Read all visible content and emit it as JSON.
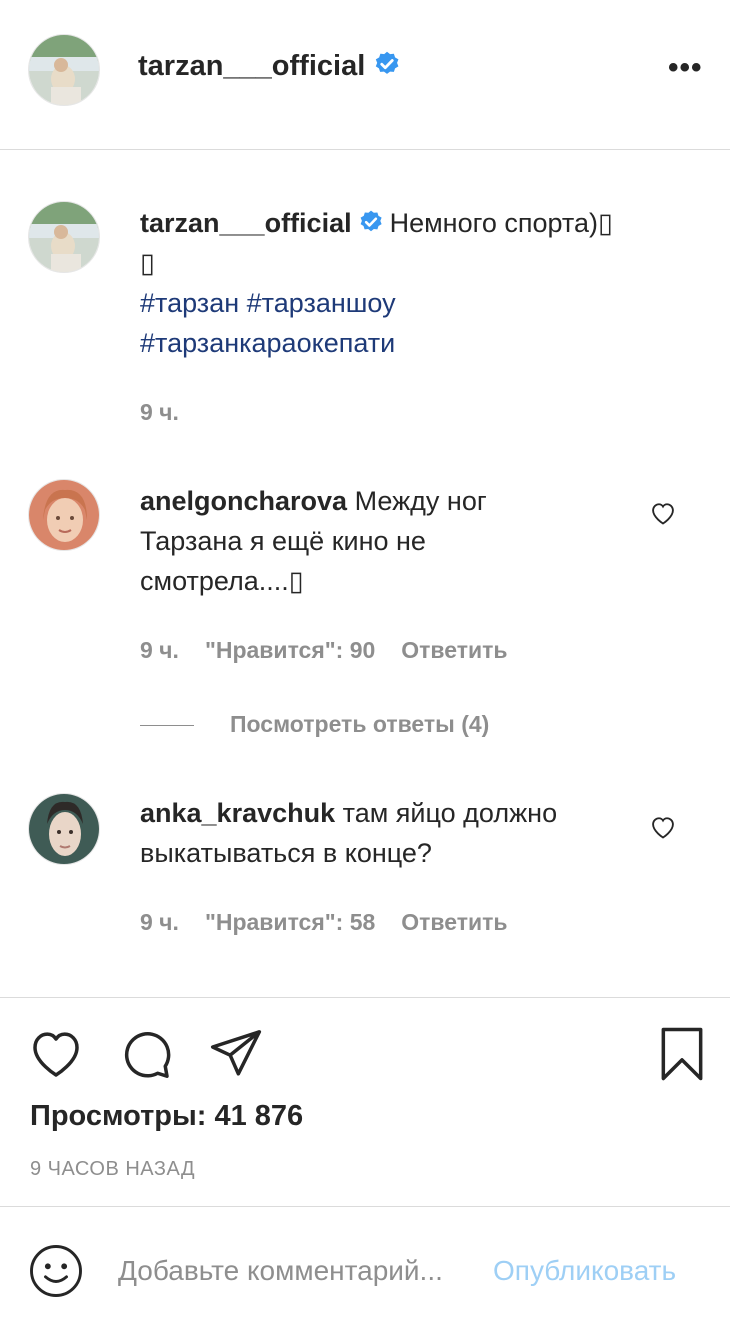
{
  "header": {
    "username": "tarzan___official",
    "more_label": "•••"
  },
  "caption": {
    "username": "tarzan___official",
    "text": "Немного спорта)▯",
    "text_line2": "▯",
    "hashtags": [
      "#тарзан",
      "#тарзаншоу",
      "#тарзанкараокепати"
    ],
    "time": "9 ч."
  },
  "comments": [
    {
      "username": "anelgoncharova",
      "text_line1": "Между ног",
      "text_line2": "Тарзана я ещё кино не",
      "text_line3": "смотрела....▯",
      "time": "9 ч.",
      "likes": "\"Нравится\": 90",
      "reply": "Ответить",
      "view_replies": "Посмотреть ответы (4)"
    },
    {
      "username": "anka_kravchuk",
      "text_line1": "там яйцо должно",
      "text_line2": "выкатываться в конце?",
      "time": "9 ч.",
      "likes": "\"Нравится\": 58",
      "reply": "Ответить"
    }
  ],
  "actions": {
    "views": "Просмотры: 41 876",
    "time_ago": "9 ЧАСОВ НАЗАД"
  },
  "composer": {
    "placeholder": "Добавьте комментарий...",
    "publish_label": "Опубликовать"
  },
  "colors": {
    "verified": "#3897f0",
    "link": "#1e3a78",
    "muted": "#8e8e8e",
    "publish": "#9ecff5"
  }
}
